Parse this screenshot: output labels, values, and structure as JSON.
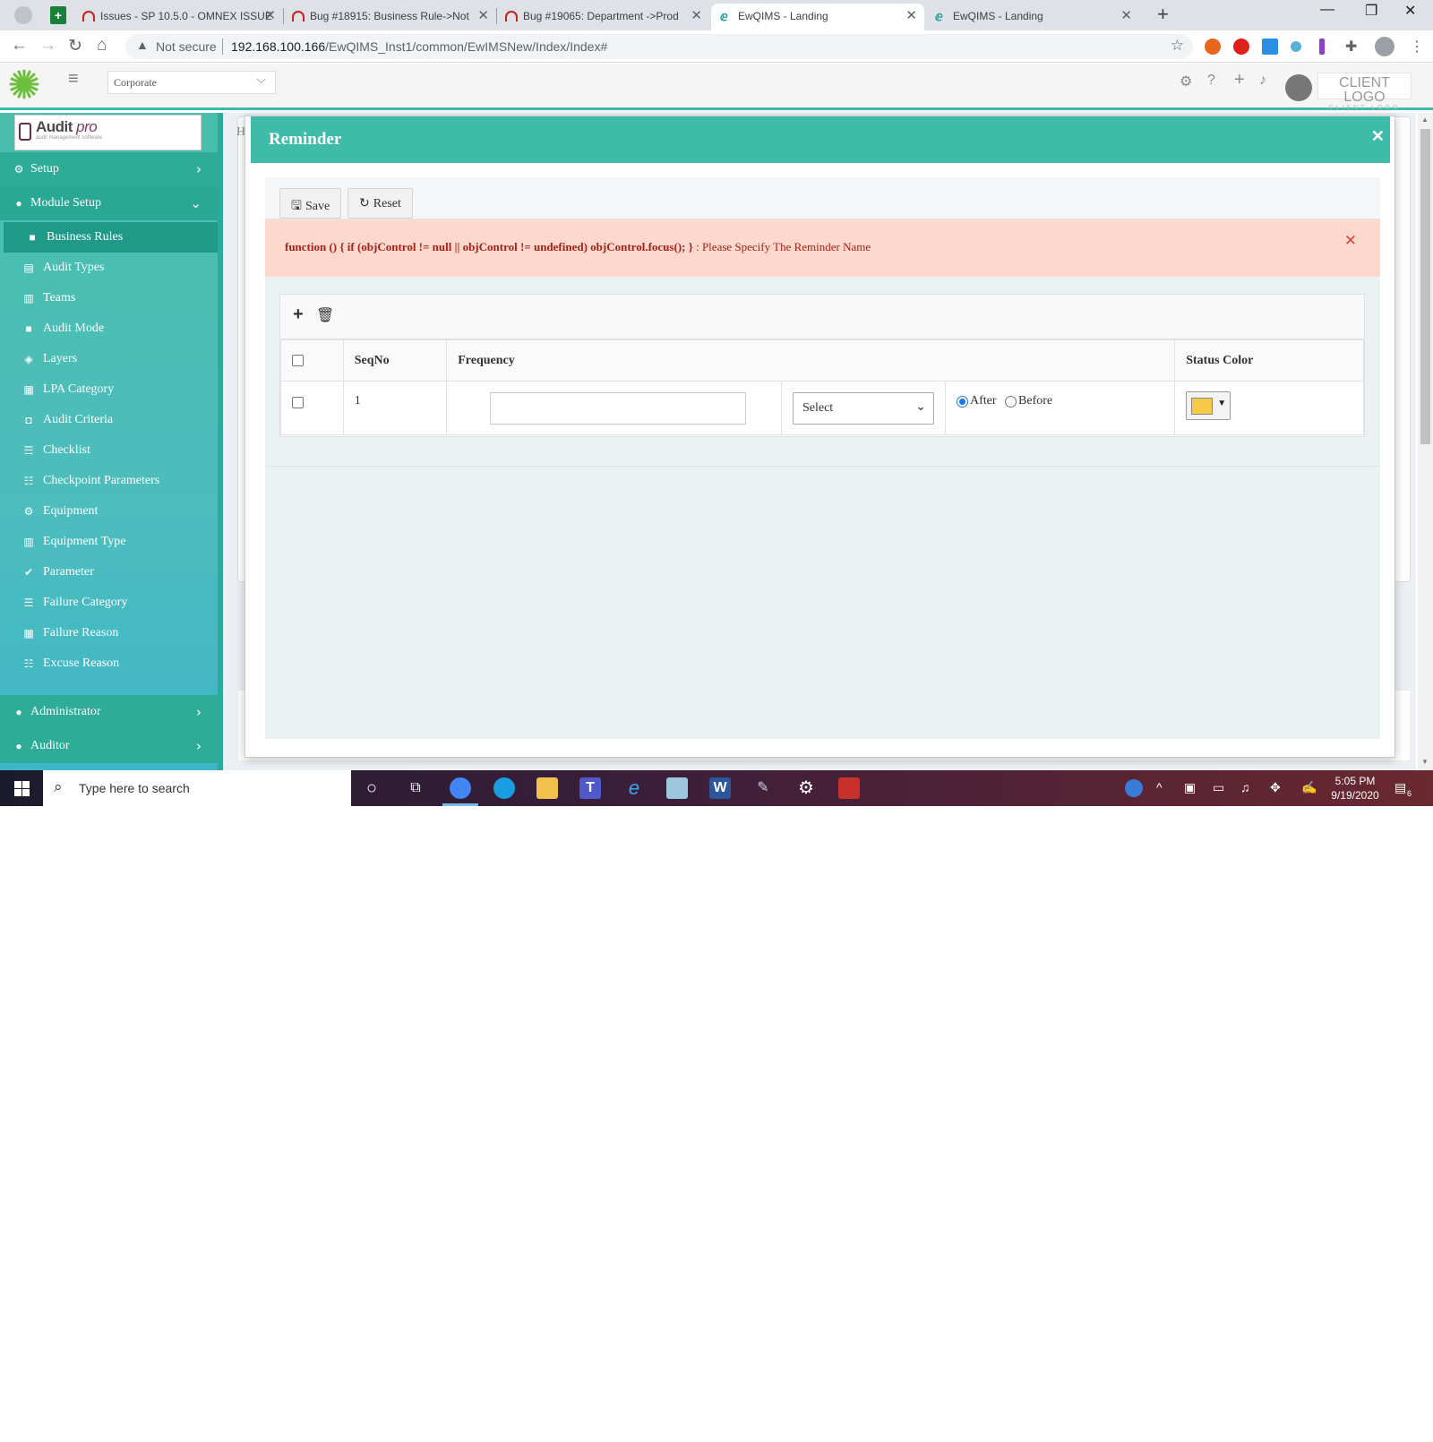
{
  "browser": {
    "tabs": [
      {
        "title": "Issues - SP 10.5.0 - OMNEX ISSUE",
        "icon": "bug-tracker-icon",
        "active": false
      },
      {
        "title": "Bug #18915: Business Rule->Not",
        "icon": "bug-tracker-icon",
        "active": false
      },
      {
        "title": "Bug #19065: Department ->Prod",
        "icon": "bug-tracker-icon",
        "active": false
      },
      {
        "title": "EwQIMS - Landing",
        "icon": "ewqims-icon",
        "active": true
      },
      {
        "title": "EwQIMS - Landing",
        "icon": "ewqims-icon",
        "active": false
      }
    ],
    "security_label": "Not secure",
    "url_host": "192.168.100.166",
    "url_path": "/EwQIMS_Inst1/common/EwIMSNew/Index/Index#"
  },
  "header": {
    "company_select": "Corporate",
    "client_logo": "CLIENT LOGO",
    "client_logo_sub": "CLIENT LOGO"
  },
  "sidebar": {
    "brand_name": "Audit",
    "brand_name_italic": "pro",
    "brand_tagline": "audit management software",
    "groups": [
      {
        "label": "Setup",
        "icon": "gear-icon"
      },
      {
        "label": "Module Setup",
        "icon": "users-icon"
      },
      {
        "label": "Administrator",
        "icon": "user-gear-icon"
      },
      {
        "label": "Auditor",
        "icon": "user-check-icon"
      }
    ],
    "items": [
      {
        "label": "Business Rules",
        "icon": "cars-icon"
      },
      {
        "label": "Audit Types",
        "icon": "list-box-icon"
      },
      {
        "label": "Teams",
        "icon": "building-icon"
      },
      {
        "label": "Audit Mode",
        "icon": "cars-icon"
      },
      {
        "label": "Layers",
        "icon": "layers-icon"
      },
      {
        "label": "LPA Category",
        "icon": "grid-icon"
      },
      {
        "label": "Audit Criteria",
        "icon": "person-board-icon"
      },
      {
        "label": "Checklist",
        "icon": "list-icon"
      },
      {
        "label": "Checkpoint Parameters",
        "icon": "list-ol-icon"
      },
      {
        "label": "Equipment",
        "icon": "cogs-icon"
      },
      {
        "label": "Equipment Type",
        "icon": "building-icon"
      },
      {
        "label": "Parameter",
        "icon": "check-double-icon"
      },
      {
        "label": "Failure Category",
        "icon": "sliders-icon"
      },
      {
        "label": "Failure Reason",
        "icon": "table-icon"
      },
      {
        "label": "Excuse Reason",
        "icon": "tasks-icon"
      }
    ]
  },
  "content": {
    "heading_initial": "H"
  },
  "modal": {
    "title": "Reminder",
    "toolbar": {
      "save_label": "Save",
      "reset_label": "Reset"
    },
    "alert": {
      "code_text": "function () { if (objControl != null || objControl != undefined) objControl.focus(); }",
      "message": " : Please Specify The Reminder Name"
    },
    "grid": {
      "columns": [
        "SeqNo",
        "Frequency",
        "Status Color"
      ],
      "rows": [
        {
          "seq_no": "1",
          "frequency_value": "",
          "unit_select": "Select",
          "timing": "After",
          "timing_options": [
            "After",
            "Before"
          ],
          "status_color": "#f7c948"
        }
      ]
    }
  },
  "taskbar": {
    "search_placeholder": "Type here to search",
    "time": "5:05 PM",
    "date": "9/19/2020",
    "notification_count": "6",
    "apps": [
      "cortana-icon",
      "task-view-icon",
      "chrome-icon",
      "edge-icon",
      "file-explorer-icon",
      "teams-icon",
      "ie-icon",
      "tablet-icon",
      "word-icon",
      "paint-icon",
      "settings-icon",
      "shield-app-icon"
    ]
  }
}
